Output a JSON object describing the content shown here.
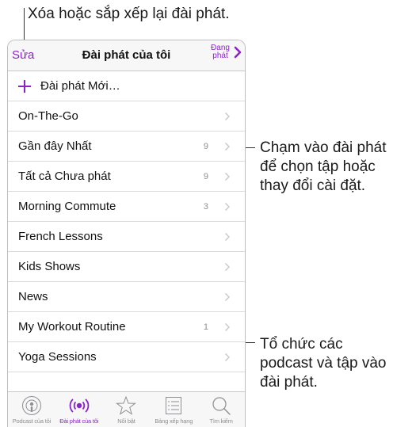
{
  "callouts": {
    "top": "Xóa hoặc sắp xếp lại đài phát.",
    "right1": "Chạm vào đài phát để chọn tập hoặc thay đổi cài đặt.",
    "right2": "Tổ chức các podcast và tập vào đài phát."
  },
  "navbar": {
    "edit": "Sửa",
    "title": "Đài phát của tôi",
    "right_line1": "Đang",
    "right_line2": "phát"
  },
  "new_station": "Đài phát Mới…",
  "rows": [
    {
      "label": "On-The-Go",
      "count": ""
    },
    {
      "label": "Gần đây Nhất",
      "count": "9"
    },
    {
      "label": "Tất cả Chưa phát",
      "count": "9"
    },
    {
      "label": "Morning Commute",
      "count": "3"
    },
    {
      "label": "French Lessons",
      "count": ""
    },
    {
      "label": "Kids Shows",
      "count": ""
    },
    {
      "label": "News",
      "count": ""
    },
    {
      "label": "My Workout Routine",
      "count": "1"
    },
    {
      "label": "Yoga Sessions",
      "count": ""
    }
  ],
  "tabs": [
    {
      "label": "Podcast của tôi",
      "icon": "podcast-icon"
    },
    {
      "label": "Đài phát của tôi",
      "icon": "stations-icon"
    },
    {
      "label": "Nổi bật",
      "icon": "star-icon"
    },
    {
      "label": "Bảng xếp hạng",
      "icon": "list-icon"
    },
    {
      "label": "Tìm kiếm",
      "icon": "search-icon"
    }
  ],
  "colors": {
    "accent": "#8a24c7",
    "gray": "#8e8e93"
  }
}
